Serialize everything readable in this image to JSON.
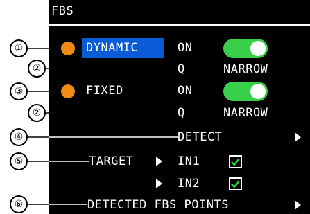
{
  "header": {
    "title": "FBS"
  },
  "dynamic": {
    "label": "DYNAMIC",
    "state": "ON",
    "q_label": "Q",
    "q_value": "NARROW"
  },
  "fixed": {
    "label": "FIXED",
    "state": "ON",
    "q_label": "Q",
    "q_value": "NARROW"
  },
  "detect": {
    "label": "DETECT"
  },
  "target": {
    "label": "TARGET",
    "in1_label": "IN1",
    "in2_label": "IN2"
  },
  "detected_points": {
    "label": "DETECTED FBS POINTS"
  },
  "callouts": [
    "①",
    "②",
    "③",
    "②",
    "④",
    "⑤",
    "⑥"
  ],
  "colors": {
    "led": "#f08c14",
    "highlight": "#0a5cd6",
    "toggle_on": "#38d048",
    "check": "#2ed040"
  }
}
